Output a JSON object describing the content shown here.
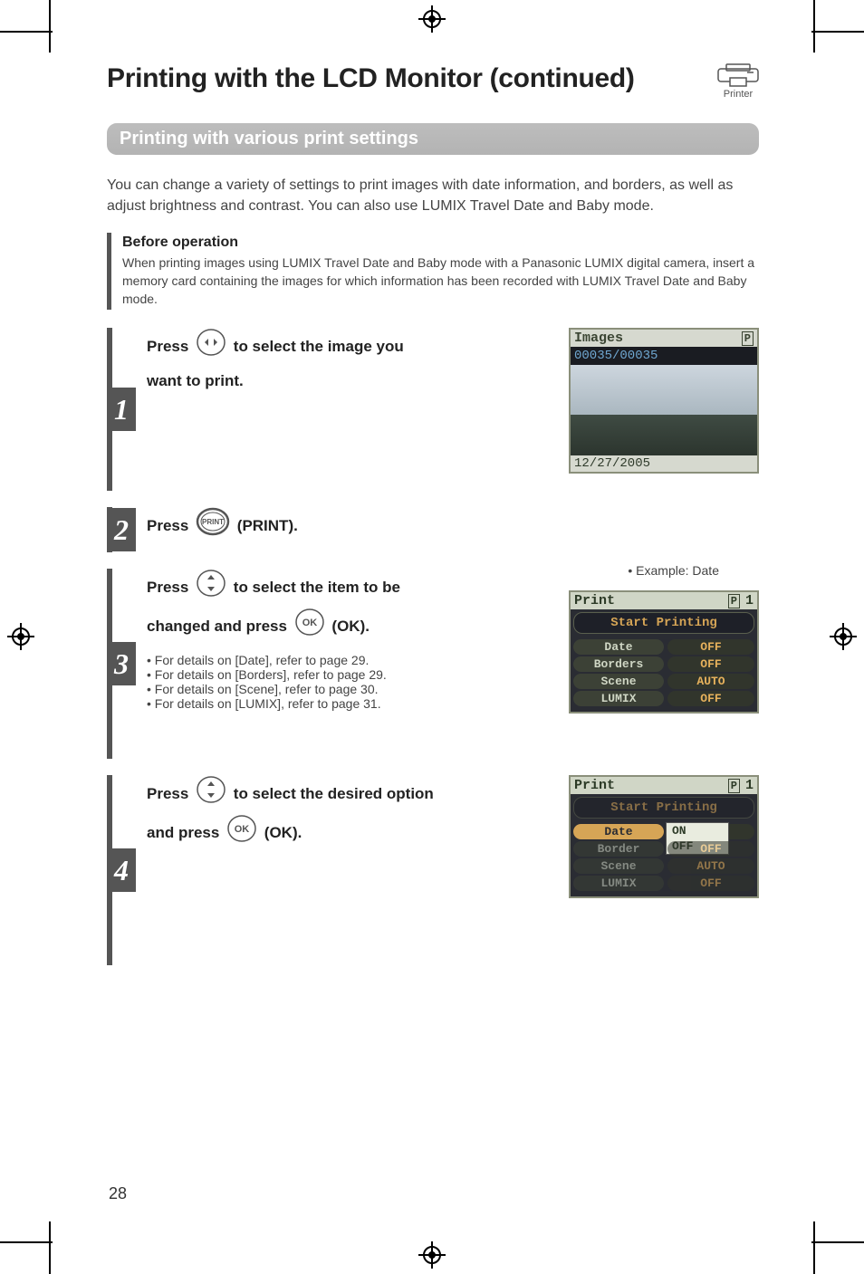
{
  "page_number": "28",
  "title": "Printing with the LCD Monitor (continued)",
  "printer_label": "Printer",
  "subtitle": "Printing with various print settings",
  "intro": "You can change a variety of settings to print images with date information, and borders, as well as adjust brightness and contrast. You can also use LUMIX Travel Date and Baby mode.",
  "before_operation": {
    "heading": "Before operation",
    "body": "When printing images using LUMIX Travel Date and Baby mode with a Panasonic LUMIX digital camera, insert a memory card containing the images for which information has been recorded with LUMIX Travel Date and Baby mode."
  },
  "steps": {
    "s1": {
      "num": "1",
      "t1": "Press ",
      "t2": " to select the image you",
      "t3": "want to print."
    },
    "s2": {
      "num": "2",
      "t1": "Press ",
      "t2": " (PRINT)."
    },
    "s3": {
      "num": "3",
      "t1": "Press ",
      "t2": " to select the item to be",
      "t3": "changed and press ",
      "t4": " (OK).",
      "details": [
        "For details on [Date], refer to page 29.",
        "For details on [Borders], refer to page 29.",
        "For details on [Scene], refer to page 30.",
        "For details on [LUMIX], refer to page 31."
      ]
    },
    "s4": {
      "num": "4",
      "t1": "Press ",
      "t2": " to select the desired option",
      "t3": "and press ",
      "t4": " (OK)."
    }
  },
  "example_label": "• Example: Date",
  "lcd1": {
    "header": "Images",
    "badge": "P",
    "count": "00035/00035",
    "date": "12/27/2005"
  },
  "lcd_menu_a": {
    "title": "Print",
    "badge": "P",
    "copies": "1",
    "start": "Start Printing",
    "rows": [
      {
        "l": "Date",
        "r": "OFF"
      },
      {
        "l": "Borders",
        "r": "OFF"
      },
      {
        "l": "Scene",
        "r": "AUTO"
      },
      {
        "l": "LUMIX",
        "r": "OFF"
      }
    ]
  },
  "lcd_menu_b": {
    "title": "Print",
    "badge": "P",
    "copies": "1",
    "start": "Start Printing",
    "rows": [
      {
        "l": "Date",
        "r": "OFF"
      },
      {
        "l": "Border",
        "r": "OFF"
      },
      {
        "l": "Scene",
        "r": "AUTO"
      },
      {
        "l": "LUMIX",
        "r": "OFF"
      }
    ],
    "popup": [
      "ON",
      "OFF"
    ]
  }
}
